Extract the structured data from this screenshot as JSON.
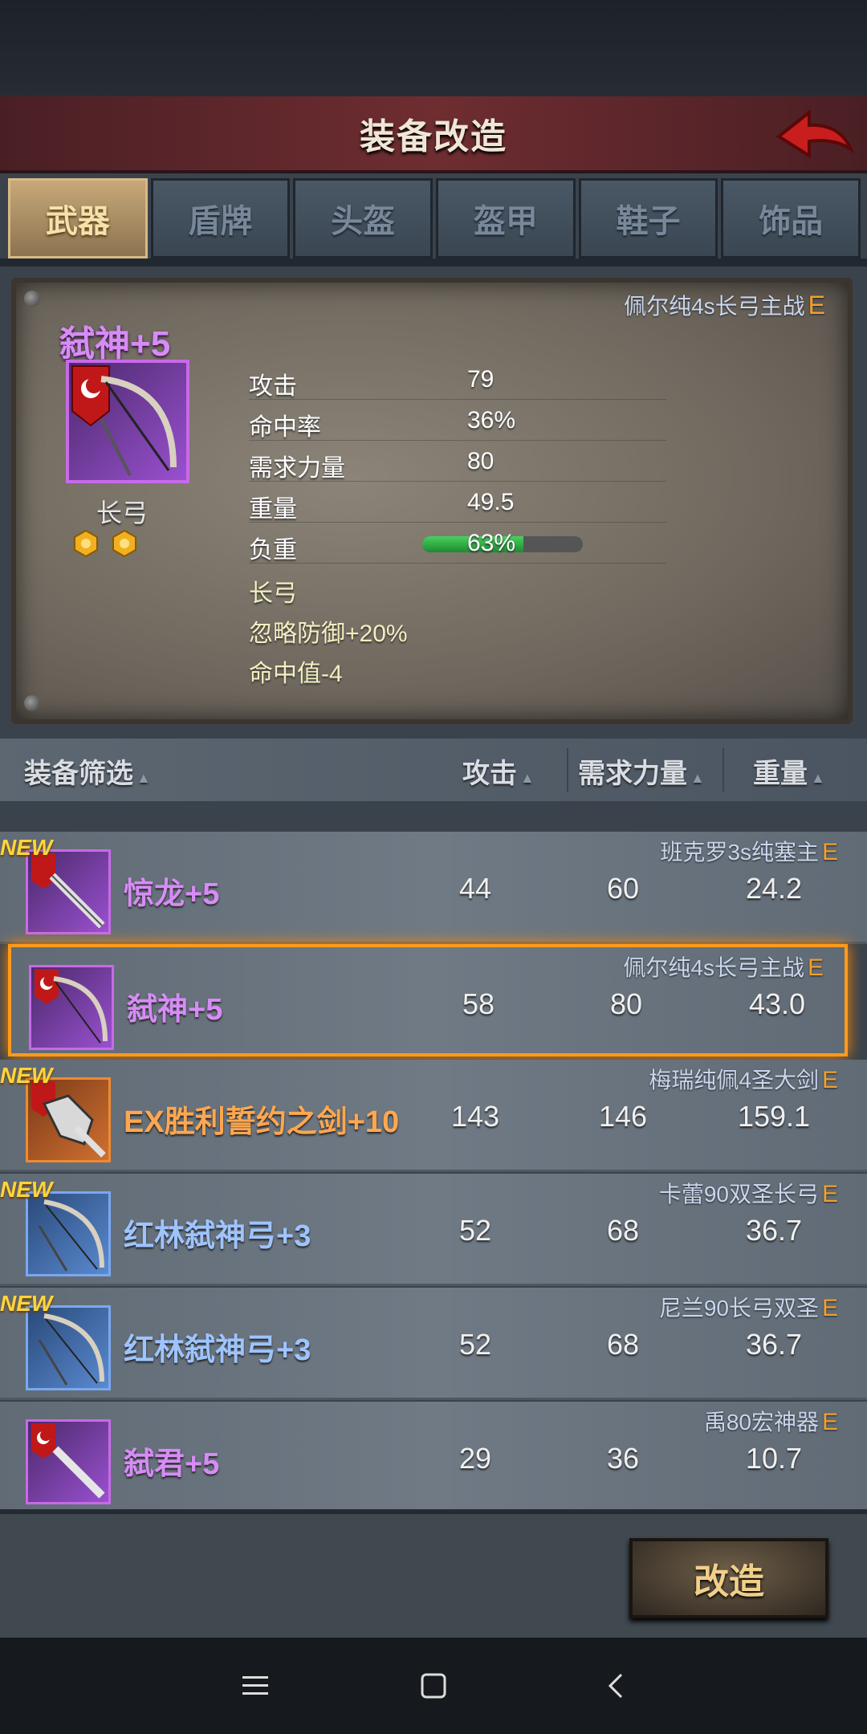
{
  "header": {
    "title": "装备改造"
  },
  "tabs": [
    {
      "label": "武器",
      "active": true
    },
    {
      "label": "盾牌",
      "active": false
    },
    {
      "label": "头盔",
      "active": false
    },
    {
      "label": "盔甲",
      "active": false
    },
    {
      "label": "鞋子",
      "active": false
    },
    {
      "label": "饰品",
      "active": false
    }
  ],
  "detail": {
    "tag": "佩尔纯4s长弓主战",
    "grade": "E",
    "name": "弑神+5",
    "type": "长弓",
    "stats": [
      {
        "label": "攻击",
        "value": "79"
      },
      {
        "label": "命中率",
        "value": "36%"
      },
      {
        "label": "需求力量",
        "value": "80"
      },
      {
        "label": "重量",
        "value": "49.5"
      },
      {
        "label": "负重",
        "value": "63%"
      }
    ],
    "load_fraction": 0.63,
    "effects": [
      "长弓",
      "忽略防御+20%",
      "命中值-4"
    ]
  },
  "filter": {
    "label": "装备筛选",
    "attack": "攻击",
    "strength": "需求力量",
    "weight": "重量"
  },
  "list": [
    {
      "new": "NEW",
      "tag": "班克罗3s纯塞主",
      "grade": "E",
      "name": "惊龙+5",
      "attack": "44",
      "strength": "60",
      "weight": "24.2",
      "color": "purple",
      "selected": false
    },
    {
      "new": "",
      "tag": "佩尔纯4s长弓主战",
      "grade": "E",
      "name": "弑神+5",
      "attack": "58",
      "strength": "80",
      "weight": "43.0",
      "color": "purple",
      "selected": true
    },
    {
      "new": "NEW",
      "tag": "梅瑞纯佩4圣大剑",
      "grade": "E",
      "name": "EX胜利誓约之剑+10",
      "attack": "143",
      "strength": "146",
      "weight": "159.1",
      "color": "orange",
      "selected": false
    },
    {
      "new": "NEW",
      "tag": "卡蕾90双圣长弓",
      "grade": "E",
      "name": "红林弑神弓+3",
      "attack": "52",
      "strength": "68",
      "weight": "36.7",
      "color": "blue",
      "selected": false
    },
    {
      "new": "NEW",
      "tag": "尼兰90长弓双圣",
      "grade": "E",
      "name": "红林弑神弓+3",
      "attack": "52",
      "strength": "68",
      "weight": "36.7",
      "color": "blue",
      "selected": false
    },
    {
      "new": "",
      "tag": "禹80宏神器",
      "grade": "E",
      "name": "弑君+5",
      "attack": "29",
      "strength": "36",
      "weight": "10.7",
      "color": "purple",
      "selected": false
    }
  ],
  "actions": {
    "reforge": "改造"
  },
  "icons": {
    "back": "back-arrow-icon",
    "gem": "gem-icon",
    "nav_menu": "menu-icon",
    "nav_home": "home-icon",
    "nav_back": "back-icon"
  },
  "colors": {
    "accent": "#ff9a1a",
    "purple_rarity": "#c86ae8",
    "orange_rarity": "#f08a30",
    "blue_rarity": "#7aa8f0",
    "grade": "#f0a030"
  }
}
